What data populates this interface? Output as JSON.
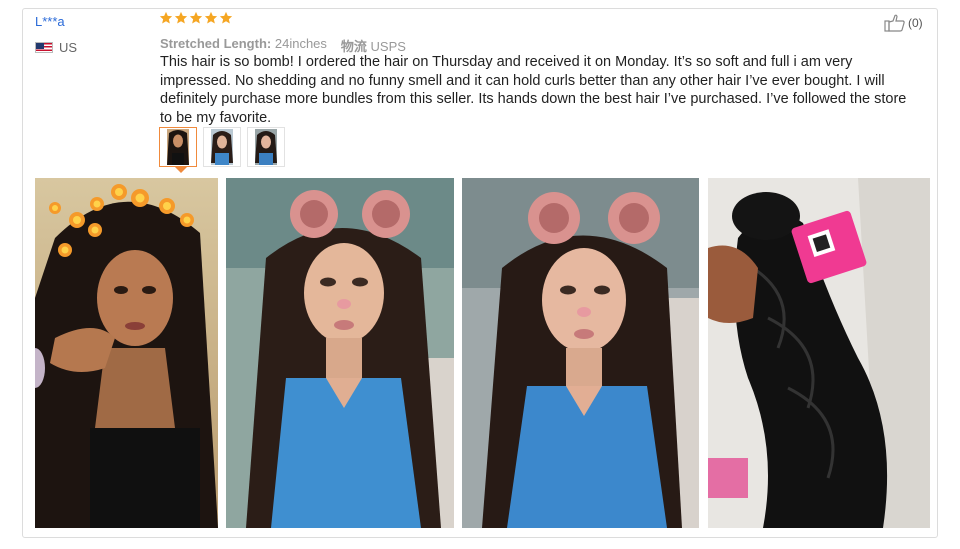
{
  "review": {
    "reviewer": "L***a",
    "country": "US",
    "rating": 5,
    "rating_color": "#f5a623",
    "stretched_length_label": "Stretched Length:",
    "stretched_length_value": "24inches",
    "shipping_label": "物流",
    "shipping_value": "USPS",
    "text": "This hair is so bomb! I ordered the hair on Thursday and received it on Monday. It’s so soft and full i am very impressed. No shedding and no funny smell and it can hold curls better than any other hair I’ve ever bought. I will definitely purchase more bundles from this seller. Its hands down the best hair I’ve purchased. I’ve followed the store to be my favorite.",
    "helpful_count": "(0)",
    "helpful_icon": "thumbs-up-icon",
    "thumbnails": [
      "review-photo-1",
      "review-photo-2",
      "review-photo-3"
    ],
    "active_thumbnail": 1,
    "photos": [
      {
        "name": "selfie-with-flame-filter"
      },
      {
        "name": "selfie-with-bear-ears-filter"
      },
      {
        "name": "car-selfie-with-bear-ears-filter"
      },
      {
        "name": "hair-bundle-with-pink-tag"
      }
    ]
  }
}
